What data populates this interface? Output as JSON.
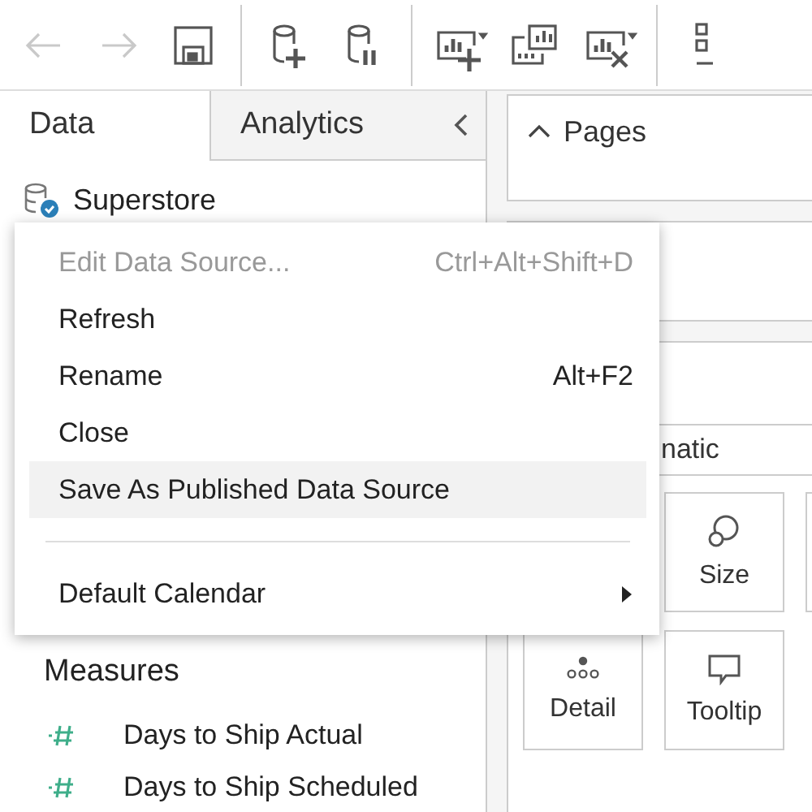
{
  "toolbar": [
    {
      "kind": "back",
      "disabled": true
    },
    {
      "kind": "forward",
      "disabled": true
    },
    {
      "kind": "save",
      "disabled": false
    },
    {
      "kind": "separator"
    },
    {
      "kind": "new-data-source",
      "disabled": false
    },
    {
      "kind": "pause-updates",
      "disabled": false
    },
    {
      "kind": "separator"
    },
    {
      "kind": "new-worksheet",
      "disabled": false
    },
    {
      "kind": "duplicate",
      "disabled": false
    },
    {
      "kind": "clear",
      "disabled": false
    },
    {
      "kind": "separator"
    },
    {
      "kind": "swap",
      "disabled": false
    }
  ],
  "data_pane": {
    "tabs": [
      {
        "label": "Data",
        "selected": true
      },
      {
        "label": "Analytics",
        "selected": false
      }
    ],
    "data_source": {
      "name": "Superstore"
    },
    "measures": {
      "heading": "Measures",
      "fields": [
        "Days to Ship Actual",
        "Days to Ship Scheduled"
      ]
    }
  },
  "pages_card": {
    "title": "Pages",
    "expanded": true
  },
  "marks_card": {
    "mark_type": "natic",
    "buttons": [
      {
        "kind": "size",
        "label": "Size"
      },
      {
        "kind": "detail",
        "label": "Detail"
      },
      {
        "kind": "tooltip",
        "label": "Tooltip"
      }
    ]
  },
  "context_menu": {
    "items": [
      {
        "kind": "item",
        "label": "Edit Data Source...",
        "shortcut": "Ctrl+Alt+Shift+D",
        "disabled": true,
        "selected": false
      },
      {
        "kind": "item",
        "label": "Refresh",
        "disabled": false,
        "selected": false
      },
      {
        "kind": "item",
        "label": "Rename",
        "shortcut": "Alt+F2",
        "disabled": false,
        "selected": false
      },
      {
        "kind": "item",
        "label": "Close",
        "disabled": false,
        "selected": false
      },
      {
        "kind": "item",
        "label": "Save As Published Data Source",
        "disabled": false,
        "selected": true
      },
      {
        "kind": "separator"
      },
      {
        "kind": "submenu",
        "label": "Default Calendar",
        "disabled": false,
        "selected": false
      }
    ]
  }
}
